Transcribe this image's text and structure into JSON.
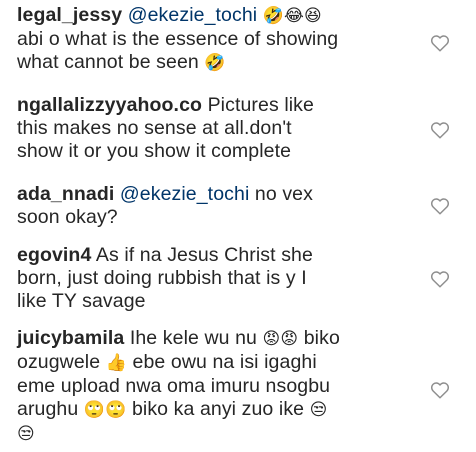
{
  "comments": [
    {
      "username": "legal_jessy",
      "mention": "@ekezie_tochi",
      "text_after_mention": "",
      "emoji_after_mention": "🤣😂😆",
      "body_line2": "abi o what is the essence of showing",
      "body_line3": "what cannot be seen",
      "emoji_end": "🤣",
      "like_icon": "heart-outline"
    },
    {
      "username": "ngallalizzyyahoo.co",
      "text": "Pictures like",
      "body_line2": "this makes no sense at all.don't",
      "body_line3": "show it or you show it complete",
      "like_icon": "heart-outline"
    },
    {
      "username": "ada_nnadi",
      "mention": "@ekezie_tochi",
      "text_after_mention": "no vex",
      "body_line2": "soon okay?",
      "like_icon": "heart-outline"
    },
    {
      "username": "egovin4",
      "text": "As if na Jesus Christ she",
      "body_line2": "born, just doing rubbish that is y I",
      "body_line3": "like TY savage",
      "like_icon": "heart-outline"
    },
    {
      "username": "juicybamila",
      "text": "Ihe kele wu nu",
      "emoji_1": "😡😡",
      "text_2": "biko",
      "line2_a": "ozugwele",
      "emoji_2": "👍",
      "line2_b": "ebe owu na isi igaghi",
      "line3": "eme upload nwa oma imuru nsogbu",
      "line4_a": "arughu",
      "emoji_3": "🙄🙄",
      "line4_b": "biko ka anyi zuo ike",
      "emoji_4": "😒",
      "emoji_5": "😒",
      "like_icon": "heart-outline"
    }
  ],
  "colors": {
    "username": "#262626",
    "mention": "#003569",
    "text": "#262626",
    "heart_outline": "#8e8e8e"
  }
}
